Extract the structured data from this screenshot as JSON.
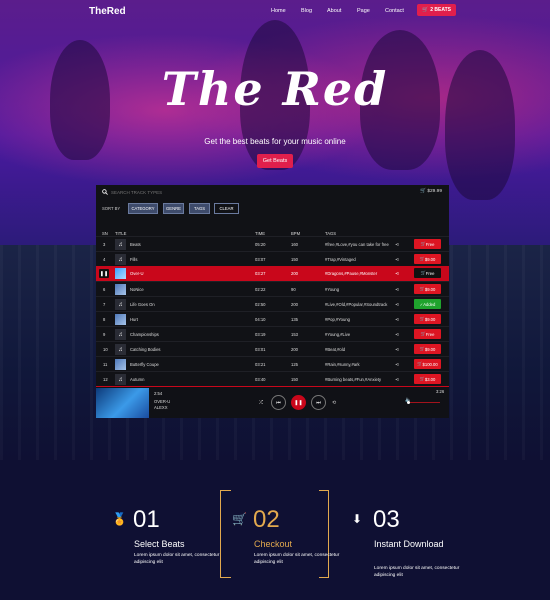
{
  "nav": {
    "logo": "TheRed",
    "links": [
      "Home",
      "Blog",
      "About",
      "Page",
      "Contact"
    ],
    "cart_label": "2 BEATS"
  },
  "hero": {
    "title": "The Red",
    "subtitle": "Get the best beats for your music online",
    "cta": "Get Beats"
  },
  "player": {
    "search_placeholder": "SEARCH TRACK TYPES",
    "cart_total": "$29.99",
    "sort_label": "SORT BY",
    "filters": [
      "CATEGORY",
      "GENRE",
      "TAGS"
    ],
    "clear_label": "CLEAR",
    "columns": [
      "SN",
      "TITLE",
      "TIME",
      "BPM",
      "TAGS"
    ],
    "tracks": [
      {
        "sn": "3",
        "title": "Beats",
        "time": "05:20",
        "bpm": "160",
        "tags": "#free,#Love,#you can take for free",
        "price": "Free",
        "style": "red",
        "art": "music"
      },
      {
        "sn": "4",
        "title": "Fills",
        "time": "03:07",
        "bpm": "150",
        "tags": "#Trap,#Vintaged",
        "price": "$9.00",
        "style": "red",
        "art": "music"
      },
      {
        "sn": "5",
        "title": "Over-U",
        "time": "03:27",
        "bpm": "200",
        "tags": "#Dragons,#Pause,#Monster",
        "price": "Free",
        "style": "dark",
        "art": "image",
        "active": true
      },
      {
        "sn": "6",
        "title": "NoNice",
        "time": "02:22",
        "bpm": "90",
        "tags": "#Young",
        "price": "$9.00",
        "style": "red",
        "art": "image"
      },
      {
        "sn": "7",
        "title": "Life Goes On",
        "time": "02:50",
        "bpm": "200",
        "tags": "#Live,#Old,#Popular,#Soundtrack",
        "price": "Added",
        "style": "green",
        "art": "music"
      },
      {
        "sn": "8",
        "title": "Hurt",
        "time": "04:10",
        "bpm": "135",
        "tags": "#Pop,#Young",
        "price": "$9.00",
        "style": "red",
        "art": "image"
      },
      {
        "sn": "9",
        "title": "Championships",
        "time": "03:19",
        "bpm": "153",
        "tags": "#Young,#Live",
        "price": "Free",
        "style": "red",
        "art": "music"
      },
      {
        "sn": "10",
        "title": "Catching Bodies",
        "time": "03:01",
        "bpm": "200",
        "tags": "#Beat,#old",
        "price": "$9.00",
        "style": "red",
        "art": "music"
      },
      {
        "sn": "11",
        "title": "Butterfly Coupe",
        "time": "03:21",
        "bpm": "125",
        "tags": "#Rain,#sunny,#ark",
        "price": "$100.00",
        "style": "red",
        "art": "image"
      },
      {
        "sn": "12",
        "title": "Autumn",
        "time": "03:40",
        "bpm": "150",
        "tags": "#Burning beats,#Fun,#Anxiety",
        "price": "$3.00",
        "style": "red",
        "art": "music"
      }
    ],
    "now_playing": {
      "elapsed": "2:54",
      "title": "OVER-U",
      "artist": "ALEXX",
      "duration": "3:26"
    }
  },
  "features": [
    {
      "num": "01",
      "title": "Select Beats",
      "text": "Lorem ipsum dolor sit amet, consectetur adipiscing elit",
      "icon": "medal-icon",
      "color": "#ffffff"
    },
    {
      "num": "02",
      "title": "Checkout",
      "text": "Lorem ipsum dolor sit amet, consectetur adipiscing elit",
      "icon": "cart-icon",
      "color": "#e2a94e"
    },
    {
      "num": "03",
      "title": "Instant Download",
      "text": "Lorem ipsum dolor sit amet, consectetur adipiscing elit",
      "icon": "download-icon",
      "color": "#ffffff"
    }
  ],
  "colors": {
    "accent": "#e11f4c",
    "active_row": "#c9071b",
    "gold": "#e2a94e",
    "navy": "#0f1033"
  }
}
